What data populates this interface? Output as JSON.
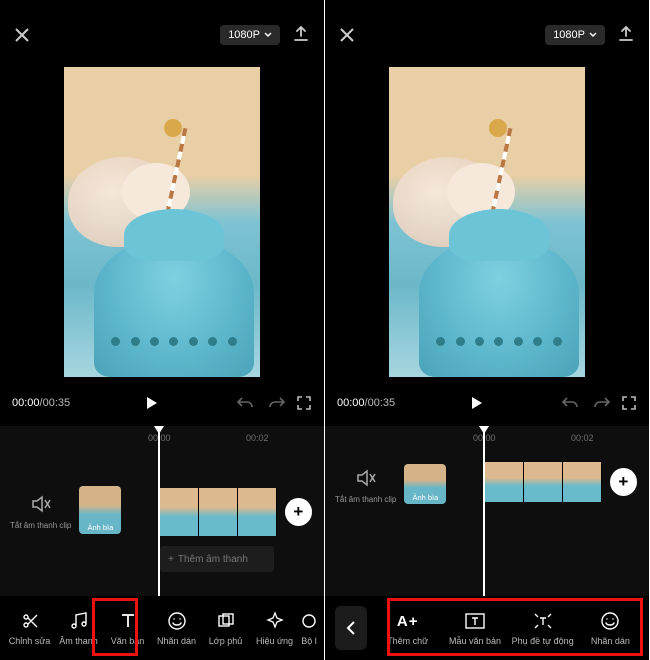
{
  "left": {
    "header": {
      "resolution": "1080P"
    },
    "transport": {
      "current": "00:00",
      "duration": "00:35"
    },
    "ruler": {
      "t0": "00:00",
      "t1": "00:02"
    },
    "trackButtons": {
      "mute": "Tắt âm thanh clip",
      "cover": "Ảnh bìa"
    },
    "audioStub": "Thêm âm thanh",
    "tools": [
      {
        "name": "edit",
        "label": "Chỉnh sửa"
      },
      {
        "name": "audio",
        "label": "Âm thanh"
      },
      {
        "name": "text",
        "label": "Văn bản"
      },
      {
        "name": "sticker",
        "label": "Nhãn dán"
      },
      {
        "name": "overlay",
        "label": "Lớp phủ"
      },
      {
        "name": "effect",
        "label": "Hiệu ứng"
      },
      {
        "name": "filter",
        "label": "Bộ l"
      }
    ]
  },
  "right": {
    "header": {
      "resolution": "1080P"
    },
    "transport": {
      "current": "00:00",
      "duration": "00:35"
    },
    "ruler": {
      "t0": "00:00",
      "t1": "00:02"
    },
    "trackButtons": {
      "mute": "Tắt âm thanh clip",
      "cover": "Ảnh bìa"
    },
    "tools": [
      {
        "name": "addtext",
        "label": "Thêm chữ"
      },
      {
        "name": "template",
        "label": "Mẫu văn bản"
      },
      {
        "name": "autosub",
        "label": "Phụ đề tự động"
      },
      {
        "name": "sticker",
        "label": "Nhãn dán"
      }
    ]
  }
}
